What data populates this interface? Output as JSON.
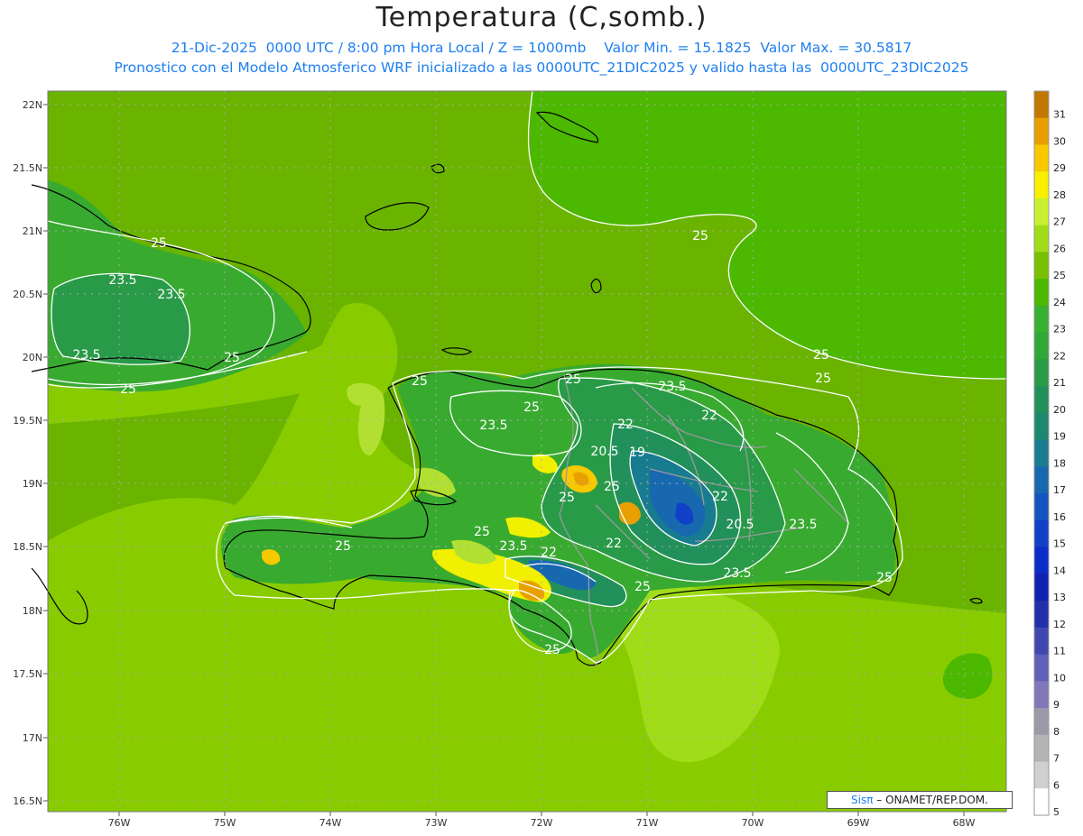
{
  "title": "Temperatura (C,somb.)",
  "subtitle_line1": "21-Dic-2025  0000 UTC / 8:00 pm Hora Local / Z = 1000mb    Valor Min. = 15.1825  Valor Max. = 30.5817",
  "subtitle_line2": "Pronostico con el Modelo Atmosferico WRF inicializado a las 0000UTC_21DIC2025 y valido hasta las  0000UTC_23DIC2025",
  "credit": {
    "brand": "Sisπ",
    "text": "– ONAMET/REP.DOM."
  },
  "map": {
    "lon_range": [
      -76.7,
      -67.6
    ],
    "lat_range": [
      17.4,
      22.1
    ],
    "lat_ticks": [
      "22N",
      "21.5N",
      "21N",
      "20.5N",
      "20N",
      "19.5N",
      "19N",
      "18.5N",
      "18N",
      "17.5N",
      "17N",
      "16.5N"
    ],
    "lon_ticks": [
      "76W",
      "75W",
      "74W",
      "73W",
      "72W",
      "71W",
      "70W",
      "69W",
      "68W"
    ],
    "contour_labels": [
      "25",
      "23.5",
      "23.5",
      "23.5",
      "25",
      "25",
      "25",
      "25",
      "25",
      "23.5",
      "23.5",
      "22",
      "22",
      "20.5",
      "19",
      "25",
      "25",
      "22",
      "20.5",
      "23.5",
      "25",
      "23.5",
      "22",
      "22",
      "23.5",
      "25",
      "25",
      "25"
    ]
  },
  "colorbar": {
    "labels": [
      "31",
      "30",
      "29",
      "28",
      "27",
      "26",
      "25",
      "24",
      "23",
      "22",
      "21",
      "20",
      "19",
      "18",
      "17",
      "16",
      "15",
      "14",
      "13",
      "12",
      "11",
      "10",
      "9",
      "8",
      "7",
      "6",
      "5"
    ],
    "colors": [
      "#c07800",
      "#e8a000",
      "#f8c800",
      "#f8f000",
      "#c8f030",
      "#a0dc18",
      "#78c000",
      "#4cb800",
      "#38b030",
      "#30a838",
      "#289a48",
      "#22905a",
      "#1c8870",
      "#187c90",
      "#1868b0",
      "#1454c0",
      "#1040c8",
      "#0c2cc8",
      "#1020b0",
      "#2030a8",
      "#4048b0",
      "#6060b8",
      "#8078b8",
      "#9a9aa8",
      "#b4b4b4",
      "#d0d0d0",
      "#ffffff"
    ]
  },
  "field_colors": {
    "t24": "#4cb800",
    "t25": "#6ab400",
    "t26": "#88cc00",
    "t27": "#b2e032",
    "t28": "#f0f000",
    "t29": "#f8c800",
    "t30": "#e8a000",
    "t23": "#38aa30",
    "t22": "#289a48",
    "t21": "#22905a",
    "t20": "#187c90",
    "t19": "#1868b0",
    "t18": "#1454c0",
    "t17": "#0c2cc8",
    "coast": "#000000",
    "border": "#999999",
    "contour": "#ffffff"
  }
}
